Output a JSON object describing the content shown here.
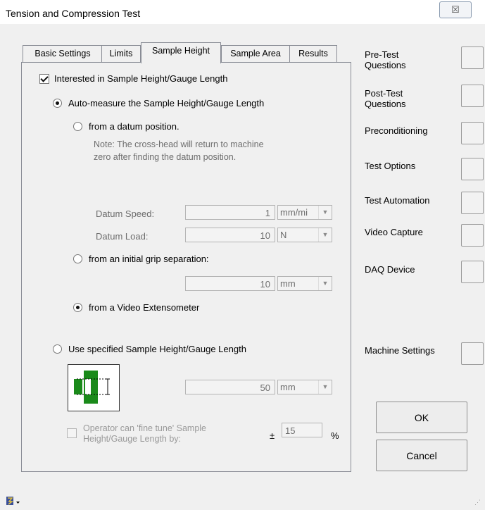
{
  "window": {
    "title": "Tension and Compression Test",
    "close_glyph": "☒"
  },
  "tabs": [
    {
      "label": "Basic Settings"
    },
    {
      "label": "Limits"
    },
    {
      "label": "Sample Height"
    },
    {
      "label": "Sample Area"
    },
    {
      "label": "Results"
    }
  ],
  "sample_height": {
    "interested_label": "Interested in Sample Height/Gauge Length",
    "interested_checked": true,
    "auto_measure_label": "Auto-measure the Sample Height/Gauge Length",
    "datum_label": "from a datum position.",
    "note_line1": "Note: The cross-head will return to machine",
    "note_line2": "zero after finding the datum position.",
    "datum_speed_label": "Datum Speed:",
    "datum_speed_value": "1",
    "datum_speed_unit": "mm/mi",
    "datum_load_label": "Datum Load:",
    "datum_load_value": "10",
    "datum_load_unit": "N",
    "grip_label": "from an initial grip separation:",
    "grip_value": "10",
    "grip_unit": "mm",
    "video_label": "from a Video Extensometer",
    "specified_label": "Use specified Sample Height/Gauge Length",
    "specified_value": "50",
    "specified_unit": "mm",
    "fine_tune_line1": "Operator can 'fine tune' Sample",
    "fine_tune_line2": "Height/Gauge Length by:",
    "plus_minus": "±",
    "fine_tune_value": "15",
    "fine_tune_unit": "%"
  },
  "side": {
    "pre_test": [
      "Pre-Test",
      "Questions"
    ],
    "post_test": [
      "Post-Test",
      "Questions"
    ],
    "preconditioning": "Preconditioning",
    "test_options": "Test Options",
    "test_automation": "Test Automation",
    "video_capture": "Video Capture",
    "daq_device": "DAQ Device",
    "machine_settings": "Machine Settings",
    "ok": "OK",
    "cancel": "Cancel"
  },
  "colors": {
    "sample_green": "#1a8a1a",
    "frame": "#898c95"
  }
}
